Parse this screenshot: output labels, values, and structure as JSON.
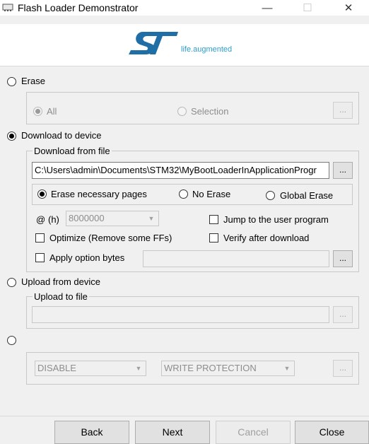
{
  "window": {
    "title": "Flash Loader Demonstrator",
    "minimize_glyph": "—",
    "maximize_glyph": "☐",
    "close_glyph": "✕"
  },
  "banner": {
    "logo_text": "ST",
    "tagline": "life.augmented",
    "brand_color": "#1f6ea6",
    "accent_color": "#2a9fd0"
  },
  "erase": {
    "label": "Erase",
    "selected": false,
    "all_label": "All",
    "selection_label": "Selection",
    "browse_label": "..."
  },
  "download": {
    "label": "Download to device",
    "selected": true,
    "group_title": "Download from file",
    "file_path": "C:\\Users\\admin\\Documents\\STM32\\MyBootLoaderInApplicationProgr",
    "browse_label": "...",
    "erase_options": {
      "necessary_label": "Erase necessary pages",
      "no_erase_label": "No Erase",
      "global_label": "Global Erase",
      "selected": "necessary"
    },
    "address_prefix": "@",
    "address_unit": "(h)",
    "address_value": "8000000",
    "jump_label": "Jump to the user program",
    "optimize_label": "Optimize (Remove some FFs)",
    "verify_label": "Verify after download",
    "apply_option_label": "Apply option bytes",
    "apply_option_value": "",
    "apply_browse_label": "..."
  },
  "upload": {
    "label": "Upload from device",
    "selected": false,
    "group_title": "Upload to file",
    "file_path": "",
    "browse_label": "..."
  },
  "protection": {
    "selected": false,
    "state_value": "DISABLE",
    "type_value": "WRITE PROTECTION",
    "browse_label": "..."
  },
  "footer": {
    "back_label": "Back",
    "next_label": "Next",
    "cancel_label": "Cancel",
    "close_label": "Close"
  }
}
